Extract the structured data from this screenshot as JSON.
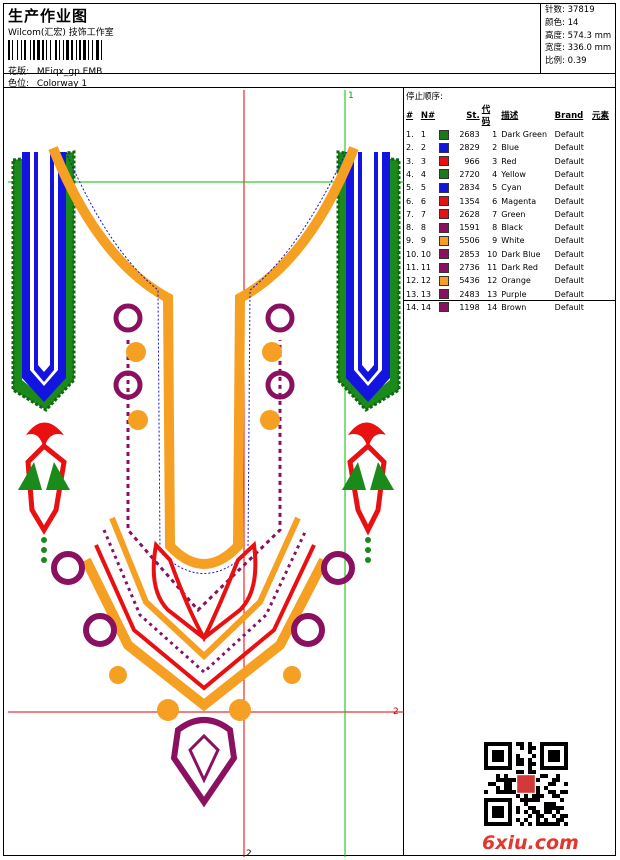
{
  "header": {
    "title": "生产作业图",
    "company": "Wilcom(汇宏) 技饰工作室",
    "design_label": "花版:",
    "design_value": "MEiqx_gp.EMB",
    "colorway_label": "色位:",
    "colorway_value": "Colorway 1"
  },
  "stats": [
    {
      "label": "针数:",
      "value": "37819"
    },
    {
      "label": "颜色:",
      "value": "14"
    },
    {
      "label": "高度:",
      "value": "574.3 mm"
    },
    {
      "label": "宽度:",
      "value": "336.0 mm"
    },
    {
      "label": "比例:",
      "value": "0.39"
    }
  ],
  "stop_sequence": {
    "heading": "停止顺序:",
    "columns": [
      "#",
      "N#",
      "St.",
      "代码",
      "描述",
      "Brand",
      "元素"
    ],
    "rows": [
      {
        "idx": "1.",
        "n": "1",
        "color": "#1a7a1a",
        "st": "2683",
        "code": "1",
        "desc": "Dark Green",
        "brand": "Default"
      },
      {
        "idx": "2.",
        "n": "2",
        "color": "#1414e0",
        "st": "2829",
        "code": "2",
        "desc": "Blue",
        "brand": "Default"
      },
      {
        "idx": "3.",
        "n": "3",
        "color": "#e81010",
        "st": "966",
        "code": "3",
        "desc": "Red",
        "brand": "Default"
      },
      {
        "idx": "4.",
        "n": "4",
        "color": "#1a7a1a",
        "st": "2720",
        "code": "4",
        "desc": "Yellow",
        "brand": "Default"
      },
      {
        "idx": "5.",
        "n": "5",
        "color": "#1414e0",
        "st": "2834",
        "code": "5",
        "desc": "Cyan",
        "brand": "Default"
      },
      {
        "idx": "6.",
        "n": "6",
        "color": "#e81010",
        "st": "1354",
        "code": "6",
        "desc": "Magenta",
        "brand": "Default"
      },
      {
        "idx": "7.",
        "n": "7",
        "color": "#e81010",
        "st": "2628",
        "code": "7",
        "desc": "Green",
        "brand": "Default"
      },
      {
        "idx": "8.",
        "n": "8",
        "color": "#8a1060",
        "st": "1591",
        "code": "8",
        "desc": "Black",
        "brand": "Default"
      },
      {
        "idx": "9.",
        "n": "9",
        "color": "#f5a023",
        "st": "5506",
        "code": "9",
        "desc": "White",
        "brand": "Default"
      },
      {
        "idx": "10.",
        "n": "10",
        "color": "#8a1060",
        "st": "2853",
        "code": "10",
        "desc": "Dark Blue",
        "brand": "Default"
      },
      {
        "idx": "11.",
        "n": "11",
        "color": "#8a1060",
        "st": "2736",
        "code": "11",
        "desc": "Dark Red",
        "brand": "Default"
      },
      {
        "idx": "12.",
        "n": "12",
        "color": "#f5a023",
        "st": "5436",
        "code": "12",
        "desc": "Orange",
        "brand": "Default"
      },
      {
        "idx": "13.",
        "n": "13",
        "color": "#8a1060",
        "st": "2483",
        "code": "13",
        "desc": "Purple",
        "brand": "Default"
      },
      {
        "idx": "14.",
        "n": "14",
        "color": "#8a1060",
        "st": "1198",
        "code": "14",
        "desc": "Brown",
        "brand": "Default"
      }
    ]
  },
  "markers": {
    "top": "1",
    "right": "2",
    "bottom": "2"
  },
  "watermark": "6xiu.com",
  "colors": {
    "green": "#1a7a1a",
    "blue": "#1414e0",
    "red": "#e81010",
    "purple": "#8a1060",
    "orange": "#f5a023",
    "guide_red": "#e00000",
    "guide_green": "#00c000"
  }
}
